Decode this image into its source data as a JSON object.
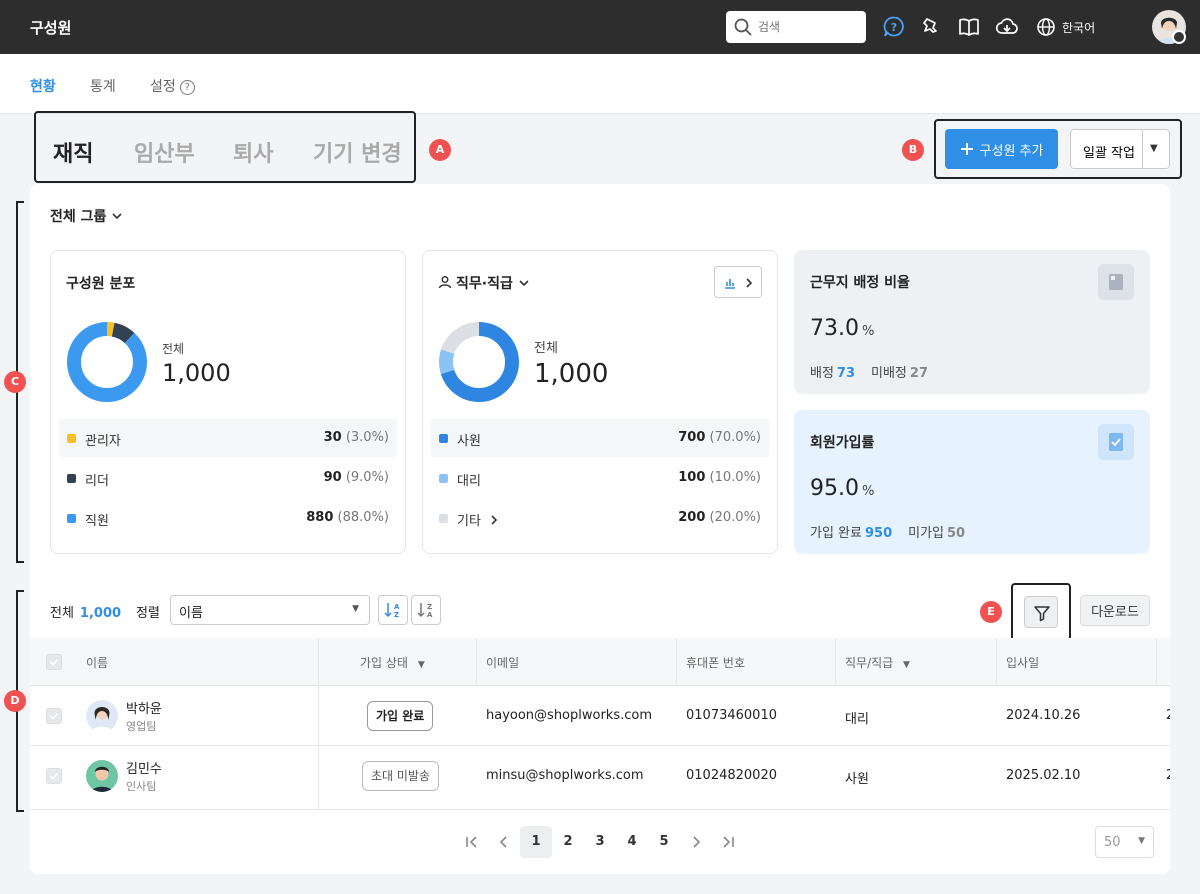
{
  "header": {
    "title": "구성원",
    "search_placeholder": "검색",
    "language": "한국어"
  },
  "subnav": {
    "tabs": [
      "현황",
      "통계",
      "설정"
    ],
    "help": "?"
  },
  "status_tabs": [
    "재직",
    "임산부",
    "퇴사",
    "기기 변경"
  ],
  "markers": {
    "a": "A",
    "b": "B",
    "c": "C",
    "d": "D",
    "e": "E"
  },
  "actions": {
    "add": "구성원 추가",
    "bulk": "일괄 작업"
  },
  "group_selector": "전체 그룹",
  "distribution": {
    "title": "구성원 분포",
    "total_label": "전체",
    "total_value": "1,000",
    "items": [
      {
        "name": "관리자",
        "value": "30",
        "pct": "(3.0%)",
        "fraction": 0.03,
        "color": "#fbbf24"
      },
      {
        "name": "리더",
        "value": "90",
        "pct": "(9.0%)",
        "fraction": 0.09,
        "color": "#334155"
      },
      {
        "name": "직원",
        "value": "880",
        "pct": "(88.0%)",
        "fraction": 0.88,
        "color": "#3b9af0"
      }
    ]
  },
  "position": {
    "title": "직무·직급",
    "total_label": "전체",
    "total_value": "1,000",
    "items": [
      {
        "name": "사원",
        "value": "700",
        "pct": "(70.0%)",
        "fraction": 0.7,
        "color": "#2f86e0"
      },
      {
        "name": "대리",
        "value": "100",
        "pct": "(10.0%)",
        "fraction": 0.1,
        "color": "#8cc3f5"
      },
      {
        "name": "기타",
        "value": "200",
        "pct": "(20.0%)",
        "fraction": 0.2,
        "color": "#dcdfe3"
      }
    ]
  },
  "workplace": {
    "title": "근무지 배정 비율",
    "value": "73.0",
    "unit": "%",
    "label1": "배정",
    "value1": "73",
    "label2": "미배정",
    "value2": "27"
  },
  "signup": {
    "title": "회원가입률",
    "value": "95.0",
    "unit": "%",
    "label1": "가입 완료",
    "value1": "950",
    "label2": "미가입",
    "value2": "50"
  },
  "toolbar": {
    "total_label": "전체",
    "total_count": "1,000",
    "sort_label": "정렬",
    "sort_value": "이름",
    "download": "다운로드"
  },
  "table": {
    "columns": [
      "이름",
      "가입 상태",
      "이메일",
      "휴대폰 번호",
      "직무/직급",
      "입사일"
    ],
    "rows": [
      {
        "name": "박하윤",
        "team": "영업팀",
        "status": "가입 완료",
        "email": "hayoon@shoplworks.com",
        "phone": "01073460010",
        "position": "대리",
        "joined": "2024.10.26",
        "extra": "2"
      },
      {
        "name": "김민수",
        "team": "인사팀",
        "status": "초대 미발송",
        "email": "minsu@shoplworks.com",
        "phone": "01024820020",
        "position": "사원",
        "joined": "2025.02.10",
        "extra": "2"
      }
    ]
  },
  "pagination": {
    "pages": [
      "1",
      "2",
      "3",
      "4",
      "5"
    ],
    "page_size": "50"
  }
}
